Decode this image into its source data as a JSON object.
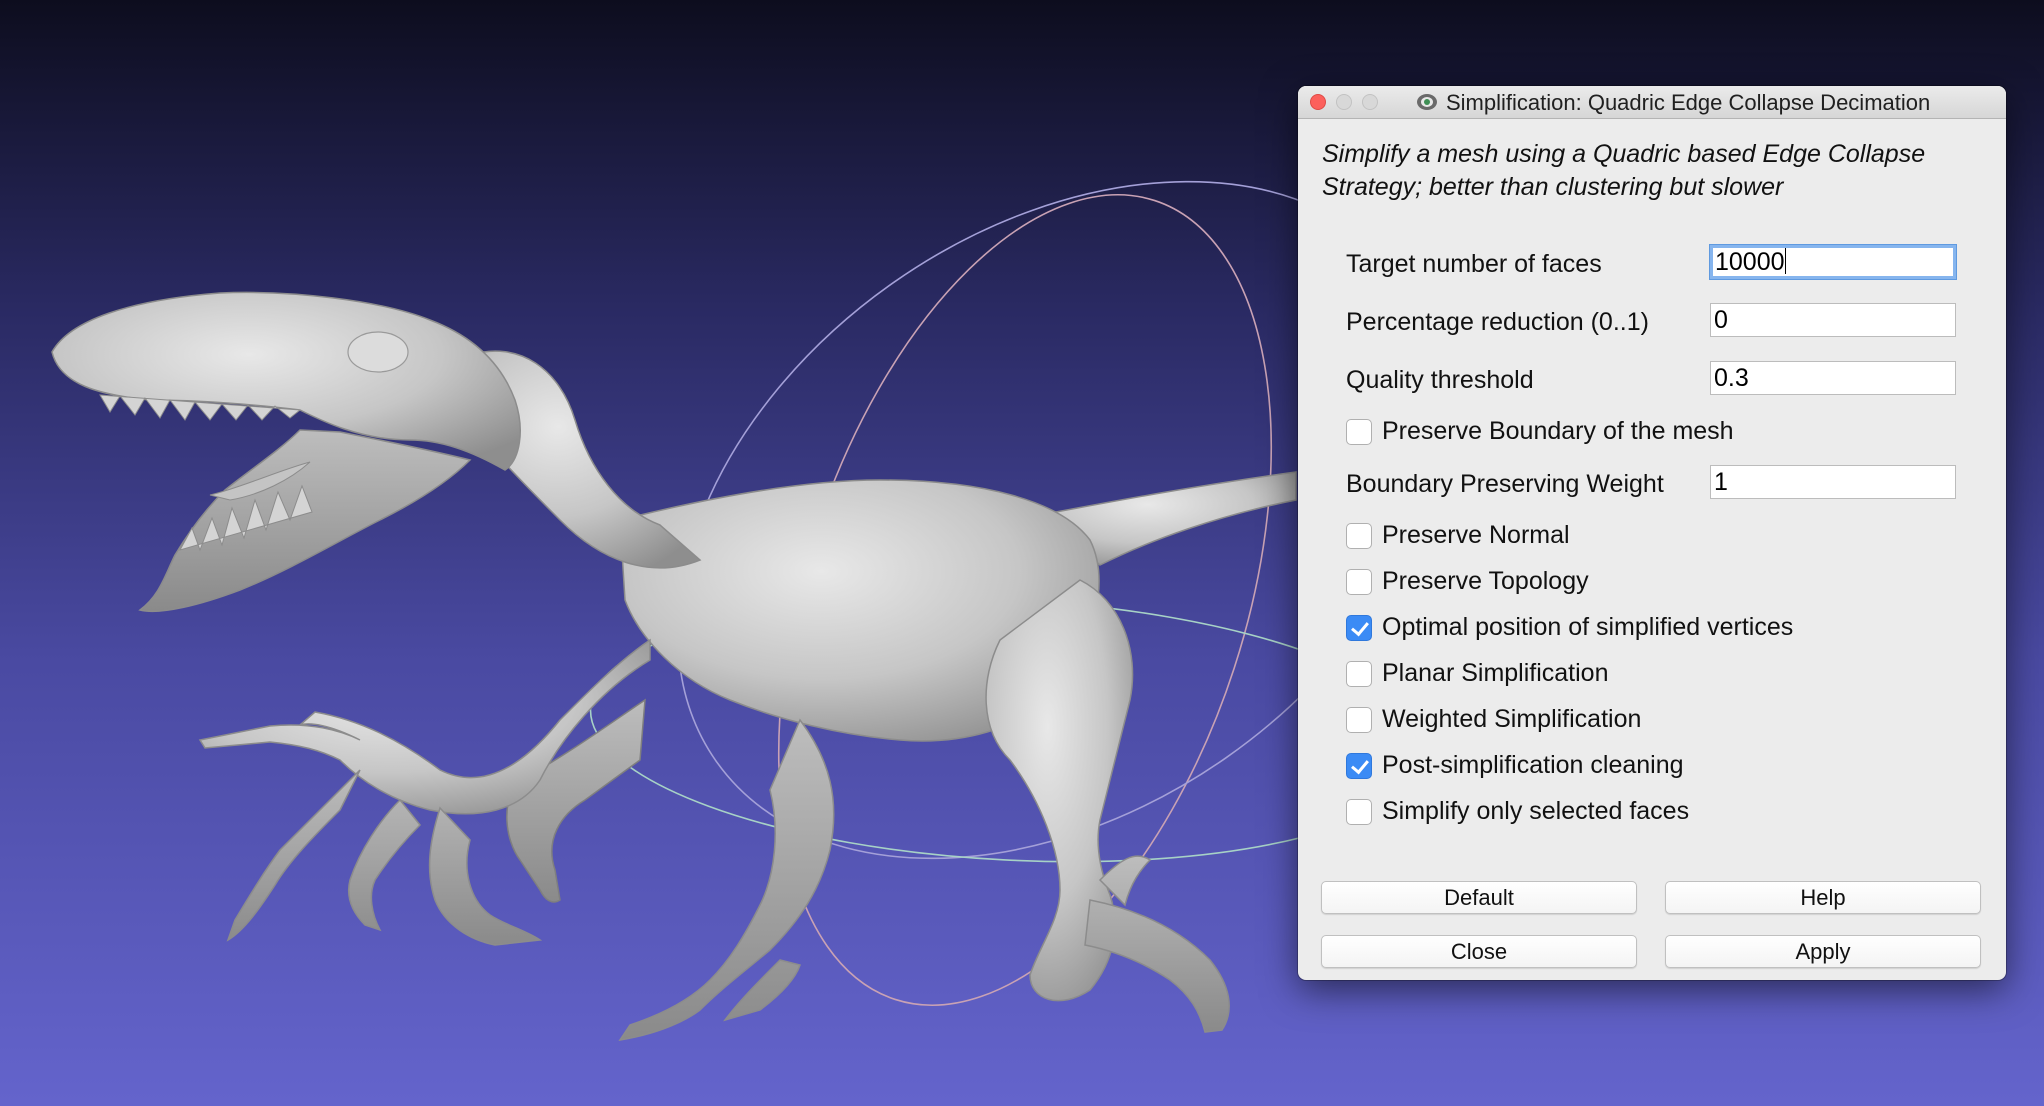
{
  "dialog": {
    "title": "Simplification: Quadric Edge Collapse Decimation",
    "description": "Simplify a mesh using a Quadric based Edge Collapse Strategy; better than clustering but slower",
    "fields": {
      "target_faces": {
        "label": "Target number of faces",
        "value": "10000"
      },
      "percentage_reduction": {
        "label": "Percentage reduction (0..1)",
        "value": "0"
      },
      "quality_threshold": {
        "label": "Quality threshold",
        "value": "0.3"
      },
      "boundary_weight": {
        "label": "Boundary Preserving Weight",
        "value": "1"
      }
    },
    "checkboxes": {
      "preserve_boundary": {
        "label": "Preserve Boundary of the mesh",
        "checked": false
      },
      "preserve_normal": {
        "label": "Preserve Normal",
        "checked": false
      },
      "preserve_topology": {
        "label": "Preserve Topology",
        "checked": false
      },
      "optimal_position": {
        "label": "Optimal position of simplified vertices",
        "checked": true
      },
      "planar_simplification": {
        "label": "Planar Simplification",
        "checked": false
      },
      "weighted_simplification": {
        "label": "Weighted Simplification",
        "checked": false
      },
      "post_cleaning": {
        "label": "Post-simplification cleaning",
        "checked": true
      },
      "selected_faces_only": {
        "label": "Simplify only selected faces",
        "checked": false
      }
    },
    "buttons": {
      "default": "Default",
      "help": "Help",
      "close": "Close",
      "apply": "Apply"
    }
  },
  "colors": {
    "background_top": "#0d0d1e",
    "background_bottom": "#6464cc",
    "mesh": "#cfcfcf",
    "checkbox_accent": "#3b8bf5",
    "focus_ring": "#86b5ee"
  }
}
